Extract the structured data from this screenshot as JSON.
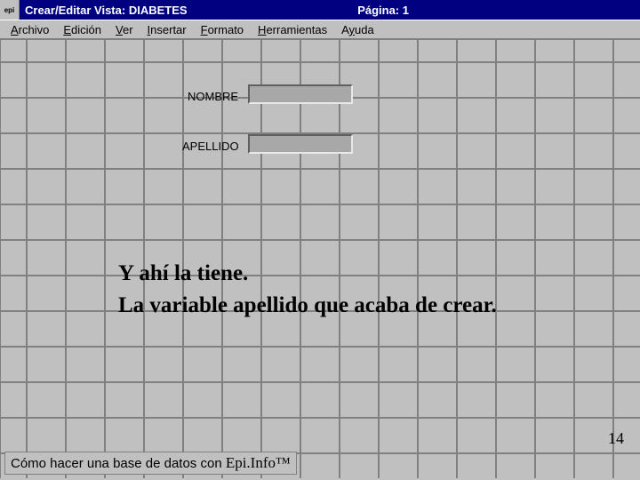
{
  "titlebar": {
    "app_icon_label": "epi",
    "title_prefix": "Crear/Editar Vista: ",
    "view_name": "DIABETES",
    "page_label": "Página: ",
    "page_number": "1"
  },
  "menu": {
    "archivo": "Archivo",
    "edicion": "Edición",
    "ver": "Ver",
    "insertar": "Insertar",
    "formato": "Formato",
    "herramientas": "Herramientas",
    "ayuda": "Ayuda"
  },
  "fields": {
    "nombre_label": "NOMBRE",
    "apellido_label": "APELLIDO"
  },
  "overlay": {
    "line1": "Y ahí la tiene.",
    "line2": "La variable apellido que acaba de crear."
  },
  "footer": {
    "text": "Cómo hacer una base de datos con ",
    "product": "Epi.Info™"
  },
  "slide_number": "14"
}
